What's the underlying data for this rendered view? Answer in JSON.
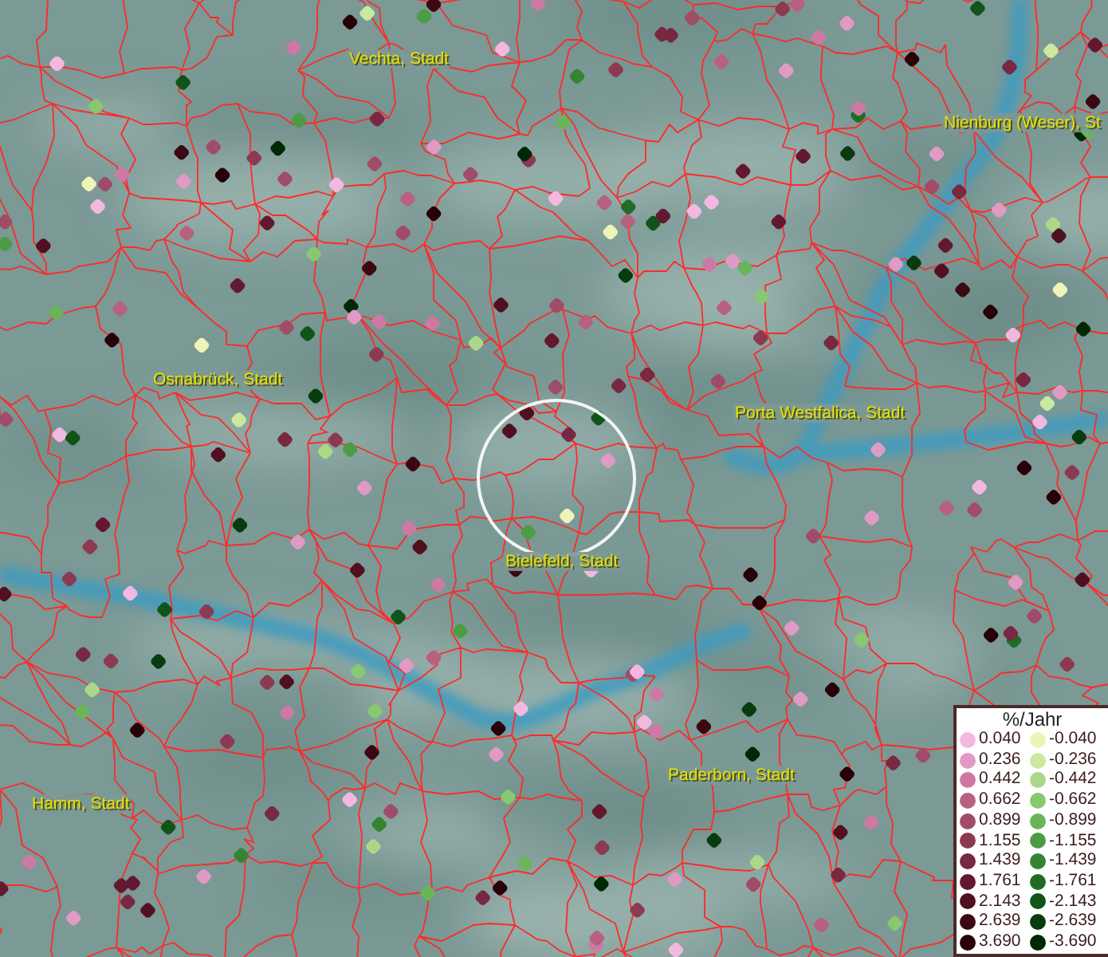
{
  "map": {
    "places": [
      {
        "name": "Vechta, Stadt"
      },
      {
        "name": "Nienburg (Weser), St"
      },
      {
        "name": "Osnabrück, Stadt"
      },
      {
        "name": "Porta Westfalica, Stadt"
      },
      {
        "name": "Bielefeld, Stadt"
      },
      {
        "name": "Hamm, Stadt"
      },
      {
        "name": "Paderborn, Stadt"
      }
    ]
  },
  "legend": {
    "title": "%/Jahr",
    "positive": [
      {
        "label": "0.040",
        "color": "#f4b8e0"
      },
      {
        "label": "0.236",
        "color": "#e09ac4"
      },
      {
        "label": "0.442",
        "color": "#cc7aa4"
      },
      {
        "label": "0.662",
        "color": "#b8607f"
      },
      {
        "label": "0.899",
        "color": "#a04c68"
      },
      {
        "label": "1.155",
        "color": "#8c3a52"
      },
      {
        "label": "1.439",
        "color": "#782840"
      },
      {
        "label": "1.761",
        "color": "#641830"
      },
      {
        "label": "2.143",
        "color": "#501020"
      },
      {
        "label": "2.639",
        "color": "#3c0812"
      },
      {
        "label": "3.690",
        "color": "#280008"
      }
    ],
    "negative": [
      {
        "label": "-0.040",
        "color": "#eef4b8"
      },
      {
        "label": "-0.236",
        "color": "#cce8a0"
      },
      {
        "label": "-0.442",
        "color": "#aad888"
      },
      {
        "label": "-0.662",
        "color": "#88c870"
      },
      {
        "label": "-0.899",
        "color": "#6ab45a"
      },
      {
        "label": "-1.155",
        "color": "#4c9c44"
      },
      {
        "label": "-1.439",
        "color": "#348434"
      },
      {
        "label": "-1.761",
        "color": "#206c24"
      },
      {
        "label": "-2.143",
        "color": "#105418"
      },
      {
        "label": "-2.639",
        "color": "#083c0e"
      },
      {
        "label": "-3.690",
        "color": "#002806"
      }
    ]
  }
}
